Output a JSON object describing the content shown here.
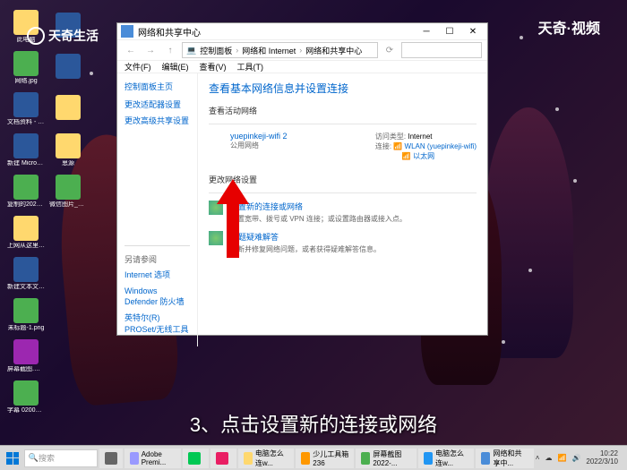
{
  "watermark": {
    "left": "天奇生活",
    "right": "天奇·视频"
  },
  "desktop_icons_col1": [
    {
      "label": "此电脑",
      "cls": "folder"
    },
    {
      "label": "网络.jpg",
      "cls": "img"
    },
    {
      "label": "文档资料 - 072030...",
      "cls": "word"
    },
    {
      "label": "新建 Microsoft...",
      "cls": "word"
    },
    {
      "label": "复制的2021 最新PNG 020000.png",
      "cls": "img"
    },
    {
      "label": "上网从这里开始.html",
      "cls": "folder"
    },
    {
      "label": "新建文本文档.txt",
      "cls": "word"
    },
    {
      "label": "未标题-1.png",
      "cls": "img"
    },
    {
      "label": "屏幕截图.mp4",
      "cls": "vid"
    },
    {
      "label": "字幕 020000.png",
      "cls": "img"
    }
  ],
  "desktop_icons_col2": [
    {
      "label": "",
      "cls": "word"
    },
    {
      "label": "",
      "cls": "word"
    },
    {
      "label": "",
      "cls": "folder"
    },
    {
      "label": "思源",
      "cls": "folder"
    },
    {
      "label": "微信图片_20220...",
      "cls": "img"
    }
  ],
  "window": {
    "title": "网络和共享中心",
    "breadcrumbs": [
      "控制面板",
      "网络和 Internet",
      "网络和共享中心"
    ],
    "search_placeholder": "",
    "menu": [
      "文件(F)",
      "编辑(E)",
      "查看(V)",
      "工具(T)"
    ],
    "sidebar": {
      "top": "控制面板主页",
      "items": [
        "更改适配器设置",
        "更改高级共享设置"
      ],
      "section": "另请参阅",
      "bottom": [
        "Internet 选项",
        "Windows Defender 防火墙",
        "英特尔(R) PROSet/无线工具"
      ]
    },
    "main": {
      "title": "查看基本网络信息并设置连接",
      "active_title": "查看活动网络",
      "net_name": "yuepinkeji-wifi 2",
      "net_type": "公用网络",
      "access_lbl": "访问类型:",
      "access_val": "Internet",
      "conn_lbl": "连接:",
      "conn_val1": "WLAN (yuepinkeji-wifi)",
      "conn_val2": "以太网",
      "change_title": "更改网络设置",
      "opt1": "设置新的连接或网络",
      "opt1_desc": "设置宽带、拨号或 VPN 连接；或设置路由器或接入点。",
      "opt2": "问题疑难解答",
      "opt2_desc": "诊断并修复网络问题，或者获得疑难解答信息。"
    }
  },
  "caption": "3、点击设置新的连接或网络",
  "taskbar": {
    "search": "搜索",
    "tasks": [
      {
        "label": "Adobe Premi...",
        "color": "#9999ff"
      },
      {
        "label": "",
        "color": "#00c853"
      },
      {
        "label": "",
        "color": "#e91e63"
      },
      {
        "label": "电脑怎么连w...",
        "color": "#ffd86e"
      },
      {
        "label": "少儿工具箱 236",
        "color": "#ff9800"
      },
      {
        "label": "屏幕截图2022-...",
        "color": "#4CAF50"
      },
      {
        "label": "电脑怎么连w...",
        "color": "#2196F3"
      },
      {
        "label": "网络和共享中...",
        "color": "#4a8cd8"
      }
    ],
    "time": "10:22",
    "date": "2022/3/10"
  }
}
